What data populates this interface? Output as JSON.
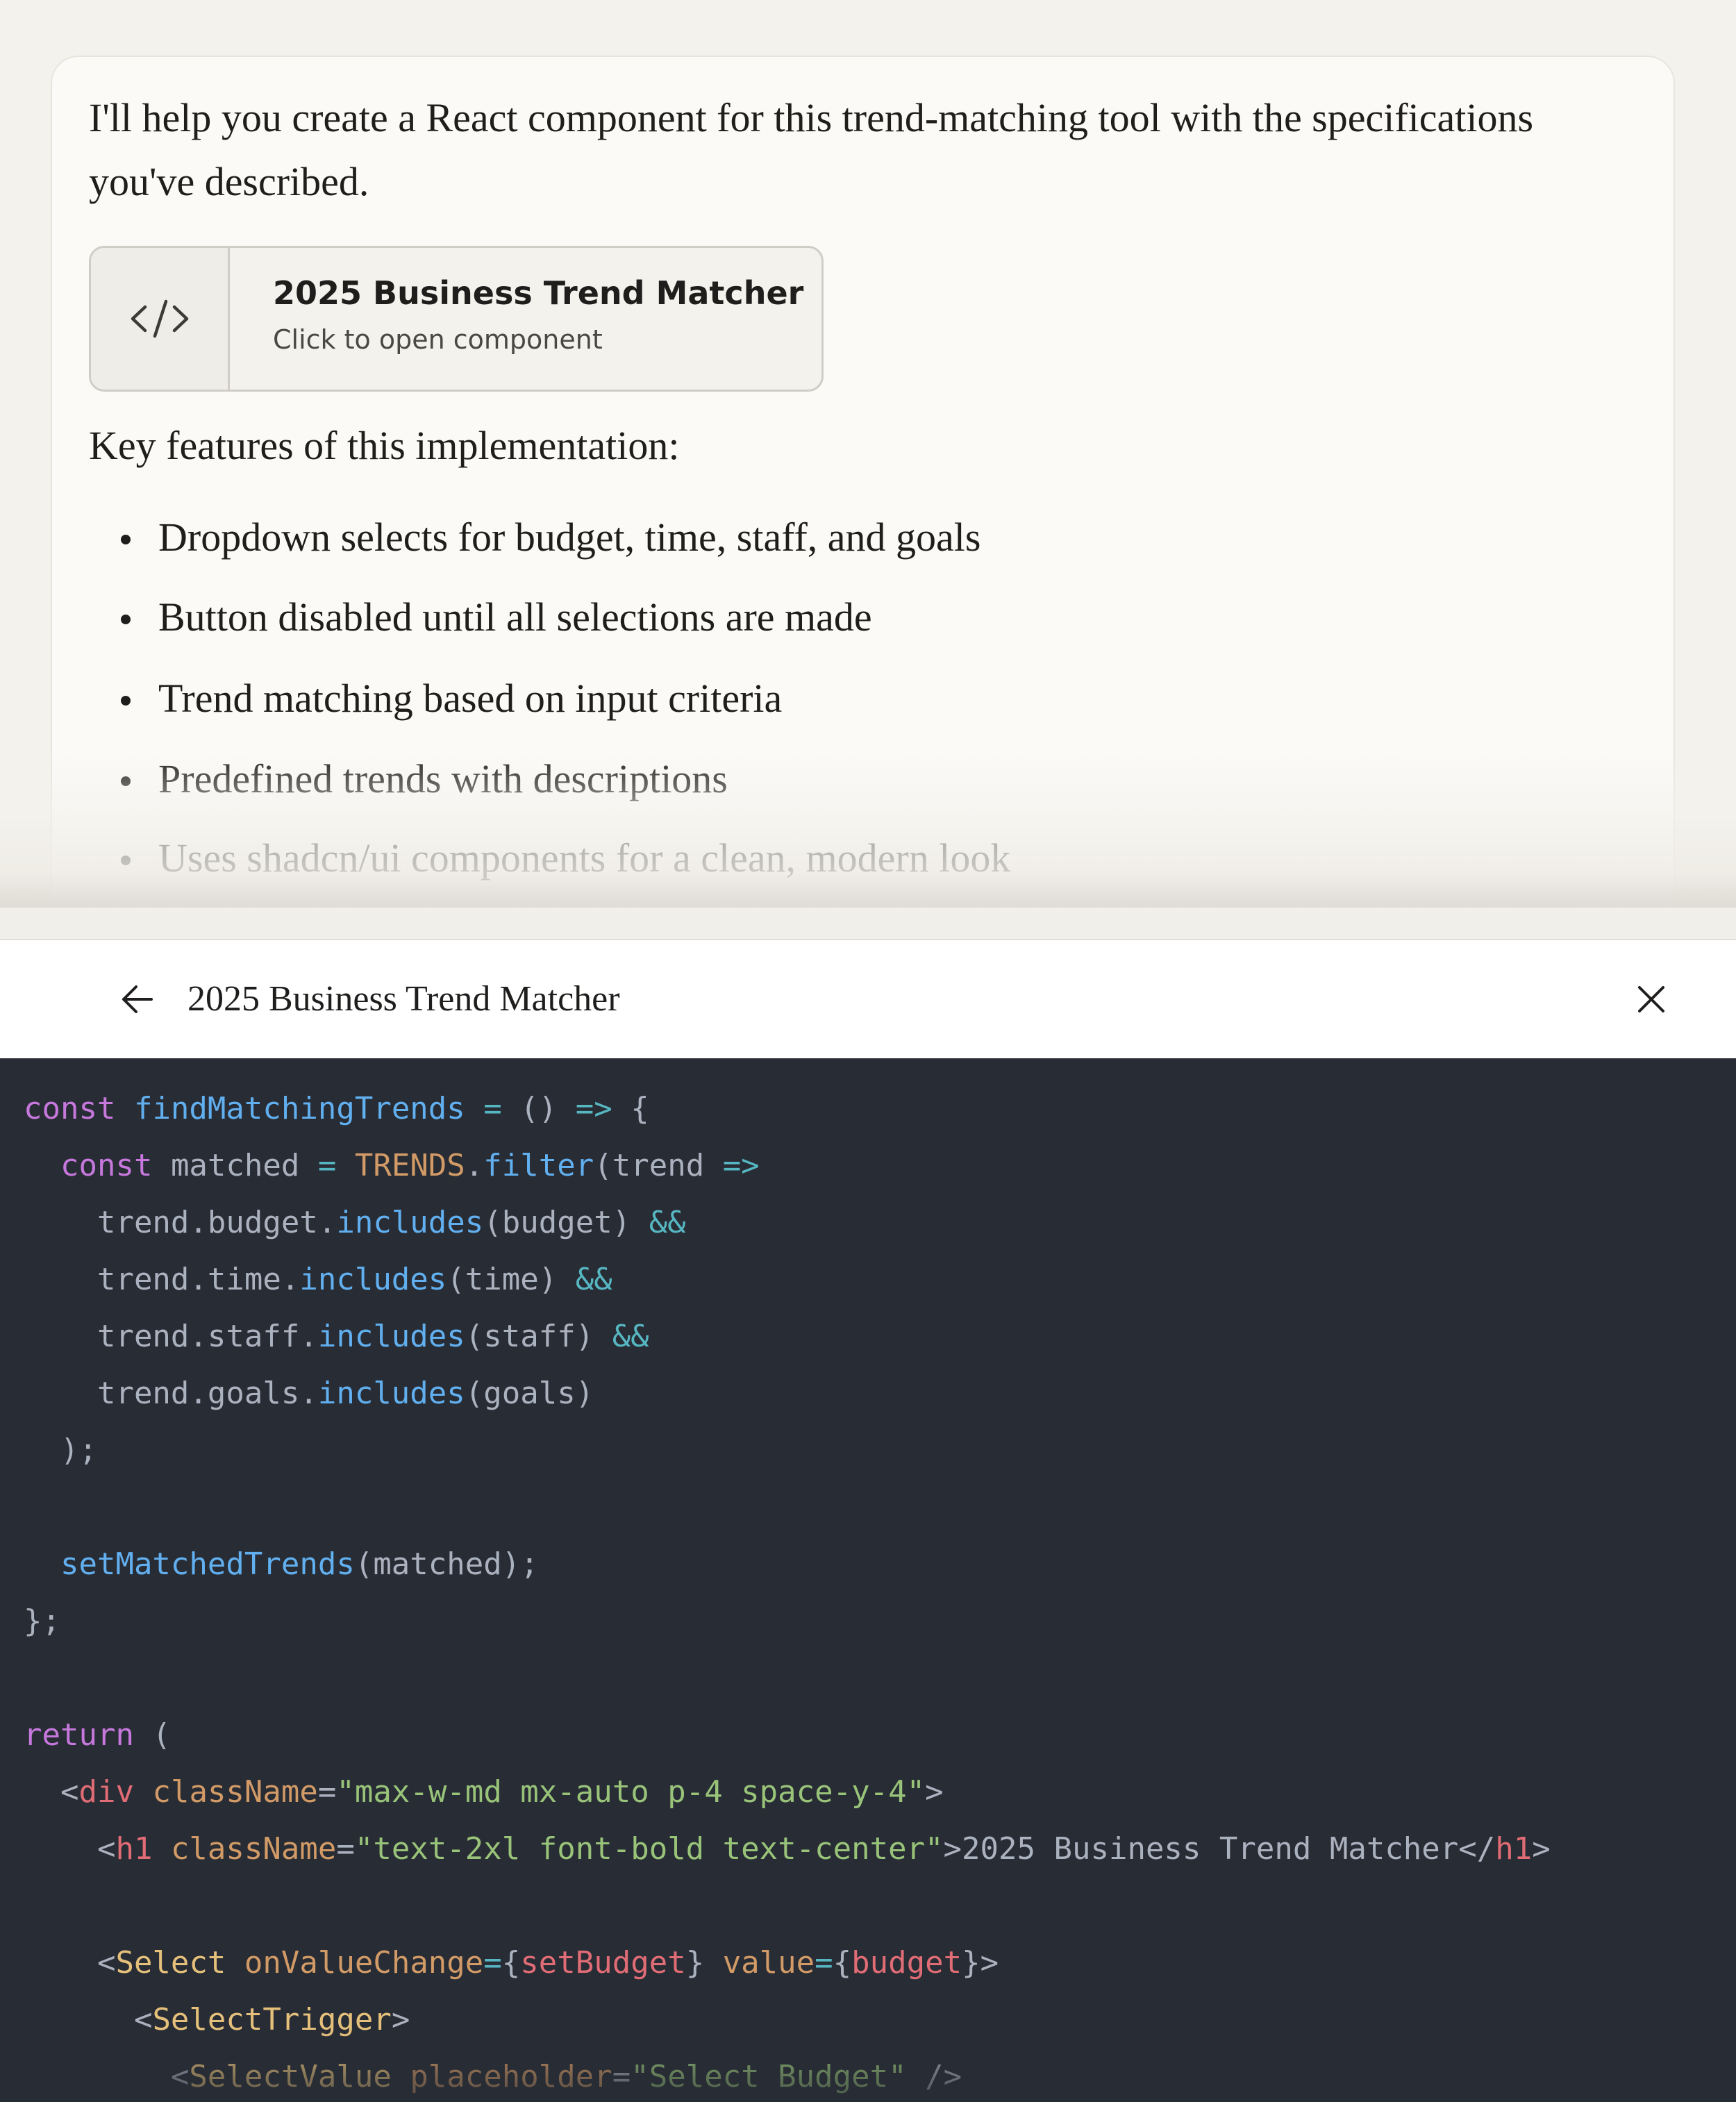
{
  "message": {
    "intro": "I'll help you create a React component for this trend-matching tool with the specifications you've described.",
    "artifact_card": {
      "title": "2025 Business Trend Matcher",
      "subtitle": "Click to open component",
      "icon": "code-icon"
    },
    "features_heading": "Key features of this implementation:",
    "features": [
      "Dropdown selects for budget, time, staff, and goals",
      "Button disabled until all selections are made",
      "Trend matching based on input criteria",
      "Predefined trends with descriptions",
      "Uses shadcn/ui components for a clean, modern look"
    ]
  },
  "artifact_panel": {
    "title": "2025 Business Trend Matcher",
    "back_icon": "arrow-left-icon",
    "close_icon": "close-icon"
  },
  "colors": {
    "chat_background": "#f4f2ed",
    "card_background": "#fbfaf7",
    "code_background": "#282c34",
    "keyword": "#c678dd",
    "function": "#61afef",
    "tag": "#e06c75",
    "attribute": "#d19a66",
    "string": "#98c379",
    "component": "#e5c07b"
  },
  "code_lines": [
    [
      {
        "t": "kw",
        "v": "const "
      },
      {
        "t": "fn",
        "v": "findMatchingTrends"
      },
      {
        "t": "op",
        "v": " = "
      },
      {
        "t": "var",
        "v": "() "
      },
      {
        "t": "op",
        "v": "=>"
      },
      {
        "t": "var",
        "v": " {"
      }
    ],
    [
      {
        "t": "var",
        "v": "  "
      },
      {
        "t": "kw",
        "v": "const "
      },
      {
        "t": "var",
        "v": "matched "
      },
      {
        "t": "op",
        "v": "= "
      },
      {
        "t": "const",
        "v": "TRENDS"
      },
      {
        "t": "var",
        "v": "."
      },
      {
        "t": "fn",
        "v": "filter"
      },
      {
        "t": "var",
        "v": "(trend "
      },
      {
        "t": "op",
        "v": "=>"
      }
    ],
    [
      {
        "t": "var",
        "v": "    trend.budget."
      },
      {
        "t": "fn",
        "v": "includes"
      },
      {
        "t": "var",
        "v": "(budget) "
      },
      {
        "t": "op",
        "v": "&&"
      }
    ],
    [
      {
        "t": "var",
        "v": "    trend.time."
      },
      {
        "t": "fn",
        "v": "includes"
      },
      {
        "t": "var",
        "v": "(time) "
      },
      {
        "t": "op",
        "v": "&&"
      }
    ],
    [
      {
        "t": "var",
        "v": "    trend.staff."
      },
      {
        "t": "fn",
        "v": "includes"
      },
      {
        "t": "var",
        "v": "(staff) "
      },
      {
        "t": "op",
        "v": "&&"
      }
    ],
    [
      {
        "t": "var",
        "v": "    trend.goals."
      },
      {
        "t": "fn",
        "v": "includes"
      },
      {
        "t": "var",
        "v": "(goals)"
      }
    ],
    [
      {
        "t": "var",
        "v": "  );"
      }
    ],
    [],
    [
      {
        "t": "var",
        "v": "  "
      },
      {
        "t": "fn",
        "v": "setMatchedTrends"
      },
      {
        "t": "var",
        "v": "(matched);"
      }
    ],
    [
      {
        "t": "var",
        "v": "};"
      }
    ],
    [],
    [
      {
        "t": "kw",
        "v": "return"
      },
      {
        "t": "var",
        "v": " ("
      }
    ],
    [
      {
        "t": "var",
        "v": "  <"
      },
      {
        "t": "tag",
        "v": "div"
      },
      {
        "t": "var",
        "v": " "
      },
      {
        "t": "attr",
        "v": "className"
      },
      {
        "t": "var",
        "v": "="
      },
      {
        "t": "str",
        "v": "\"max-w-md mx-auto p-4 space-y-4\""
      },
      {
        "t": "var",
        "v": ">"
      }
    ],
    [
      {
        "t": "var",
        "v": "    <"
      },
      {
        "t": "tag",
        "v": "h1"
      },
      {
        "t": "var",
        "v": " "
      },
      {
        "t": "attr",
        "v": "className"
      },
      {
        "t": "var",
        "v": "="
      },
      {
        "t": "str",
        "v": "\"text-2xl font-bold text-center\""
      },
      {
        "t": "var",
        "v": ">2025 Business Trend Matcher</"
      },
      {
        "t": "tag",
        "v": "h1"
      },
      {
        "t": "var",
        "v": ">"
      }
    ],
    [],
    [
      {
        "t": "var",
        "v": "    <"
      },
      {
        "t": "comp",
        "v": "Select"
      },
      {
        "t": "var",
        "v": " "
      },
      {
        "t": "attr",
        "v": "onValueChange"
      },
      {
        "t": "op",
        "v": "="
      },
      {
        "t": "var",
        "v": "{"
      },
      {
        "t": "tag",
        "v": "setBudget"
      },
      {
        "t": "var",
        "v": "} "
      },
      {
        "t": "attr",
        "v": "value"
      },
      {
        "t": "op",
        "v": "="
      },
      {
        "t": "var",
        "v": "{"
      },
      {
        "t": "tag",
        "v": "budget"
      },
      {
        "t": "var",
        "v": "}>"
      }
    ],
    [
      {
        "t": "var",
        "v": "      <"
      },
      {
        "t": "comp",
        "v": "SelectTrigger"
      },
      {
        "t": "var",
        "v": ">"
      }
    ],
    [
      {
        "t": "var",
        "v": "        <"
      },
      {
        "t": "comp",
        "v": "SelectValue"
      },
      {
        "t": "var",
        "v": " "
      },
      {
        "t": "attr",
        "v": "placeholder"
      },
      {
        "t": "var",
        "v": "="
      },
      {
        "t": "str",
        "v": "\"Select Budget\""
      },
      {
        "t": "var",
        "v": " />"
      }
    ]
  ]
}
